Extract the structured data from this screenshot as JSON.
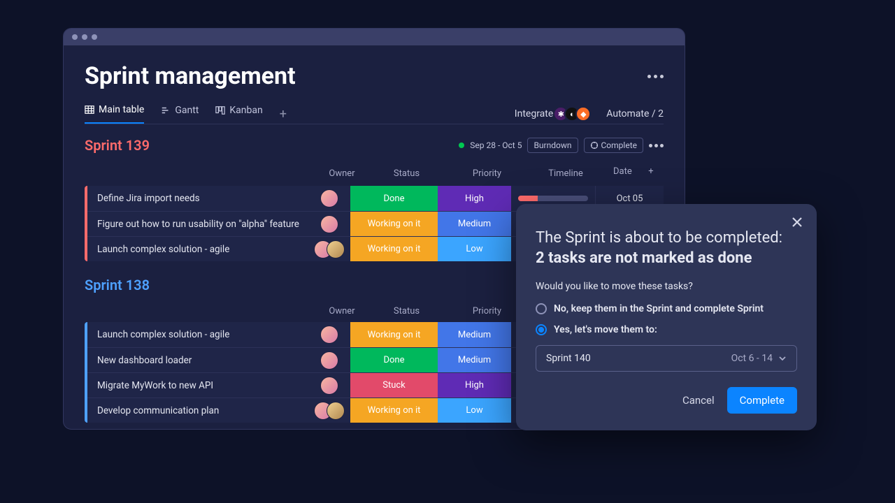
{
  "page": {
    "title": "Sprint management"
  },
  "tabs": {
    "main": "Main table",
    "gantt": "Gantt",
    "kanban": "Kanban"
  },
  "toolbar": {
    "integrate": "Integrate",
    "automate": "Automate / 2"
  },
  "sprint139": {
    "title": "Sprint 139",
    "range": "Sep 28 - Oct 5",
    "burndown": "Burndown",
    "complete": "Complete",
    "cols": {
      "owner": "Owner",
      "status": "Status",
      "priority": "Priority",
      "timeline": "Timeline",
      "date": "Date"
    },
    "rows": [
      {
        "task": "Define Jira import needs",
        "status": "Done",
        "statusCls": "st-done",
        "priority": "High",
        "prCls": "pr-high",
        "date": "Oct 05",
        "owners": 1
      },
      {
        "task": "Figure out how to run usability on \"alpha\" feature",
        "status": "Working on it",
        "statusCls": "st-work",
        "priority": "Medium",
        "prCls": "pr-med",
        "date": "",
        "owners": 1
      },
      {
        "task": "Launch complex solution - agile",
        "status": "Working on it",
        "statusCls": "st-work",
        "priority": "Low",
        "prCls": "pr-low",
        "date": "",
        "owners": 2
      }
    ]
  },
  "sprint138": {
    "title": "Sprint 138",
    "cols": {
      "owner": "Owner",
      "status": "Status",
      "priority": "Priority"
    },
    "rows": [
      {
        "task": "Launch complex solution - agile",
        "status": "Working on it",
        "statusCls": "st-work",
        "priority": "Medium",
        "prCls": "pr-med",
        "owners": 1
      },
      {
        "task": "New dashboard loader",
        "status": "Done",
        "statusCls": "st-done",
        "priority": "Medium",
        "prCls": "pr-med",
        "owners": 1
      },
      {
        "task": "Migrate MyWork to new API",
        "status": "Stuck",
        "statusCls": "st-stuck",
        "priority": "High",
        "prCls": "pr-high",
        "owners": 1
      },
      {
        "task": "Develop communication plan",
        "status": "Working on it",
        "statusCls": "st-work",
        "priority": "Low",
        "prCls": "pr-low",
        "owners": 2
      }
    ]
  },
  "dialog": {
    "title1": "The Sprint is about to be completed:",
    "title2": "2 tasks are not marked as done",
    "question": "Would you like to move these tasks?",
    "optNo": "No, keep them in the Sprint and complete Sprint",
    "optYes": "Yes, let's move them to:",
    "selectName": "Sprint 140",
    "selectRange": "Oct 6 - 14",
    "cancel": "Cancel",
    "complete": "Complete"
  }
}
